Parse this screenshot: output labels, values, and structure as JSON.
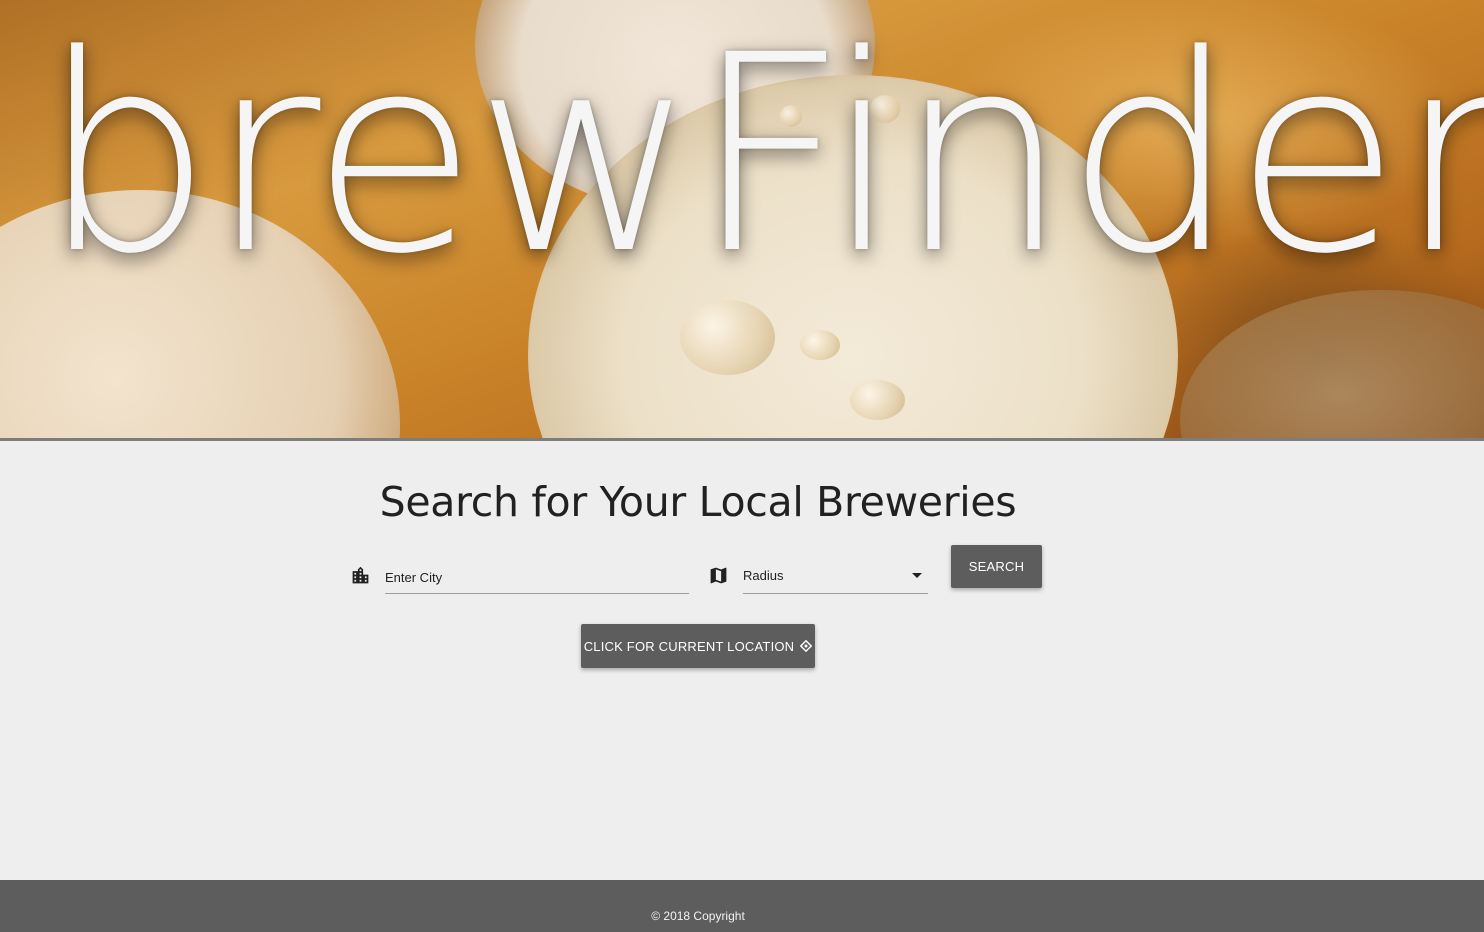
{
  "hero": {
    "brand": "brewFinder"
  },
  "search": {
    "title": "Search for Your Local Breweries",
    "city_placeholder": "Enter City",
    "city_value": "",
    "city_icon": "city-buildings-icon",
    "radius_icon": "map-icon",
    "radius_selected": "Radius",
    "search_button": "SEARCH",
    "location_button": "CLICK FOR CURRENT LOCATION",
    "location_icon": "gps-location-icon"
  },
  "footer": {
    "copyright": "© 2018 Copyright"
  },
  "colors": {
    "background": "#eeeeee",
    "button": "#5d5d5d",
    "footer": "#5d5d5d",
    "text": "#212121"
  }
}
